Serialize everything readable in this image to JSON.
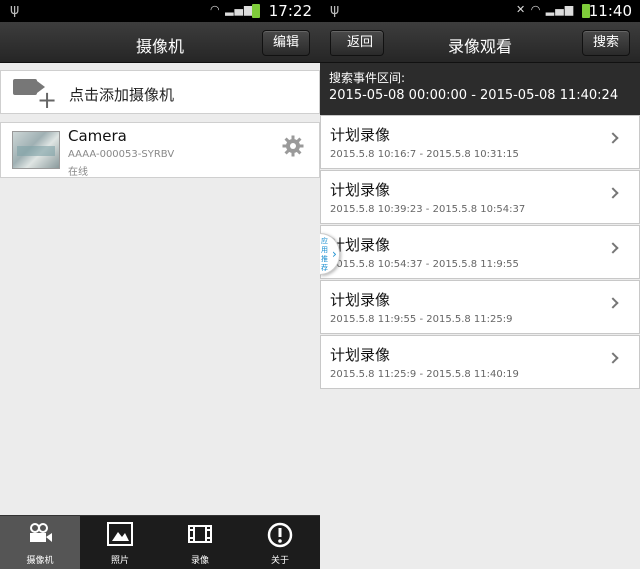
{
  "left": {
    "status_time": "17:22",
    "title": "摄像机",
    "edit_label": "编辑",
    "add_camera_label": "点击添加摄像机",
    "camera": {
      "name": "Camera",
      "id": "AAAA-000053-SYRBV",
      "status": "在线"
    },
    "tabs": [
      {
        "label": "摄像机",
        "icon": "camera-icon"
      },
      {
        "label": "照片",
        "icon": "photo-icon"
      },
      {
        "label": "录像",
        "icon": "film-icon"
      },
      {
        "label": "关于",
        "icon": "info-icon"
      }
    ]
  },
  "right": {
    "status_time": "11:40",
    "title": "录像观看",
    "back_label": "返回",
    "search_label": "搜索",
    "range_label": "搜索事件区间:",
    "range_value": "2015-05-08 00:00:00 - 2015-05-08 11:40:24",
    "promo_label": "应用推荐",
    "recordings": [
      {
        "title": "计划录像",
        "time": "2015.5.8 10:16:7 - 2015.5.8 10:31:15"
      },
      {
        "title": "计划录像",
        "time": "2015.5.8 10:39:23 - 2015.5.8 10:54:37"
      },
      {
        "title": "计划录像",
        "time": "2015.5.8 10:54:37 - 2015.5.8 11:9:55"
      },
      {
        "title": "计划录像",
        "time": "2015.5.8 11:9:55 - 2015.5.8 11:25:9"
      },
      {
        "title": "计划录像",
        "time": "2015.5.8 11:25:9 - 2015.5.8 11:40:19"
      }
    ]
  },
  "colors": {
    "titlebar": "#2e2e2e",
    "background": "#ececec",
    "battery": "#7fcc3a",
    "active_tab": "#555555"
  }
}
